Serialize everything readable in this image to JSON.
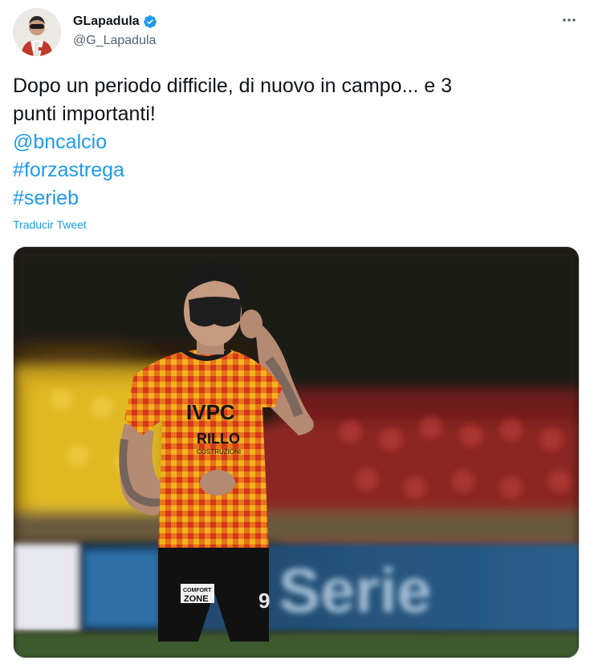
{
  "author": {
    "display_name": "GLapadula",
    "handle": "@G_Lapadula",
    "verified": true
  },
  "tweet": {
    "text_line1": "Dopo un periodo difficile, di nuovo in campo... e 3",
    "text_line2": "punti importanti!",
    "mention": "@bncalcio",
    "hashtags": [
      "#forzastrega",
      "#serieb"
    ]
  },
  "translate_label": "Traducir Tweet",
  "photo": {
    "jersey_sponsor_top": "IVPC",
    "jersey_sponsor_bottom": "RILLO",
    "jersey_sponsor_sub": "COSTRUZIONI",
    "shorts_sponsor_top": "COMFORT",
    "shorts_sponsor_bottom": "ZONE",
    "shirt_number": "9",
    "board_text": "Serie"
  },
  "colors": {
    "link": "#1d9bf0",
    "verified": "#1d9bf0",
    "secondary_text": "#536471"
  },
  "icons": {
    "verified": "verified-badge-icon",
    "more": "more-horizontal-icon"
  }
}
